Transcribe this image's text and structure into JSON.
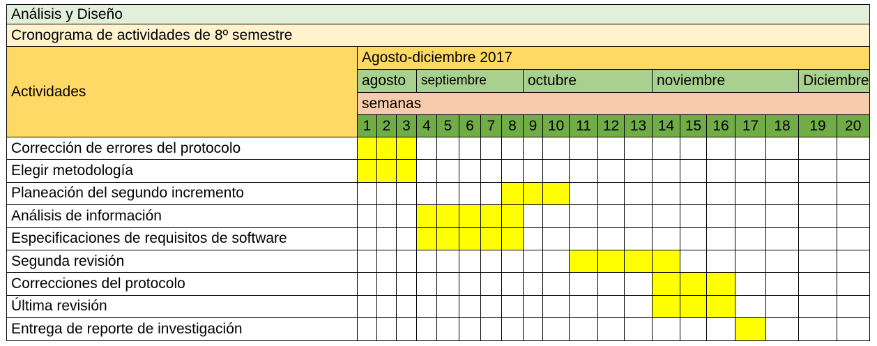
{
  "title": "Análisis y Diseño",
  "subtitle": "Cronograma de actividades de 8º semestre",
  "header": {
    "activities_label": "Actividades",
    "period_label": "Agosto-diciembre 2017",
    "weeks_label": "semanas",
    "months": [
      {
        "label": "agosto",
        "span": 3
      },
      {
        "label": "septiembre",
        "span": 5
      },
      {
        "label": "octubre",
        "span": 5
      },
      {
        "label": "noviembre",
        "span": 5
      },
      {
        "label": "Diciembre",
        "span": 5
      }
    ],
    "weeks": [
      "1",
      "2",
      "3",
      "4",
      "5",
      "6",
      "7",
      "8",
      "9",
      "10",
      "11",
      "12",
      "13",
      "14",
      "15",
      "16",
      "17",
      "18",
      "19",
      "20"
    ]
  },
  "activities": [
    {
      "label": "Corrección de errores del protocolo",
      "weeks": [
        1,
        2,
        3
      ]
    },
    {
      "label": "Elegir metodología",
      "weeks": [
        1,
        2,
        3
      ]
    },
    {
      "label": "Planeación del segundo incremento",
      "weeks": [
        8,
        9,
        10
      ]
    },
    {
      "label": "Análisis de información",
      "weeks": [
        4,
        5,
        6,
        7,
        8
      ]
    },
    {
      "label": "Especificaciones de requisitos de software",
      "weeks": [
        4,
        5,
        6,
        7,
        8
      ]
    },
    {
      "label": "Segunda revisión",
      "weeks": [
        11,
        12,
        13,
        14
      ]
    },
    {
      "label": "Correcciones del protocolo",
      "weeks": [
        14,
        15,
        16
      ]
    },
    {
      "label": "Última revisión",
      "weeks": [
        14,
        15,
        16
      ]
    },
    {
      "label": "Entrega de reporte de investigación",
      "weeks": [
        17
      ]
    }
  ],
  "colors": {
    "title_bg": "#e2efda",
    "subtitle_bg": "#fff2cc",
    "activities_bg": "#ffd966",
    "period_bg": "#ffd966",
    "month_bg": "#a9d08e",
    "weeks_label_bg": "#f8cbad",
    "week_num_bg": "#70ad47",
    "scheduled": "#ffff00",
    "grid": "#000000"
  }
}
